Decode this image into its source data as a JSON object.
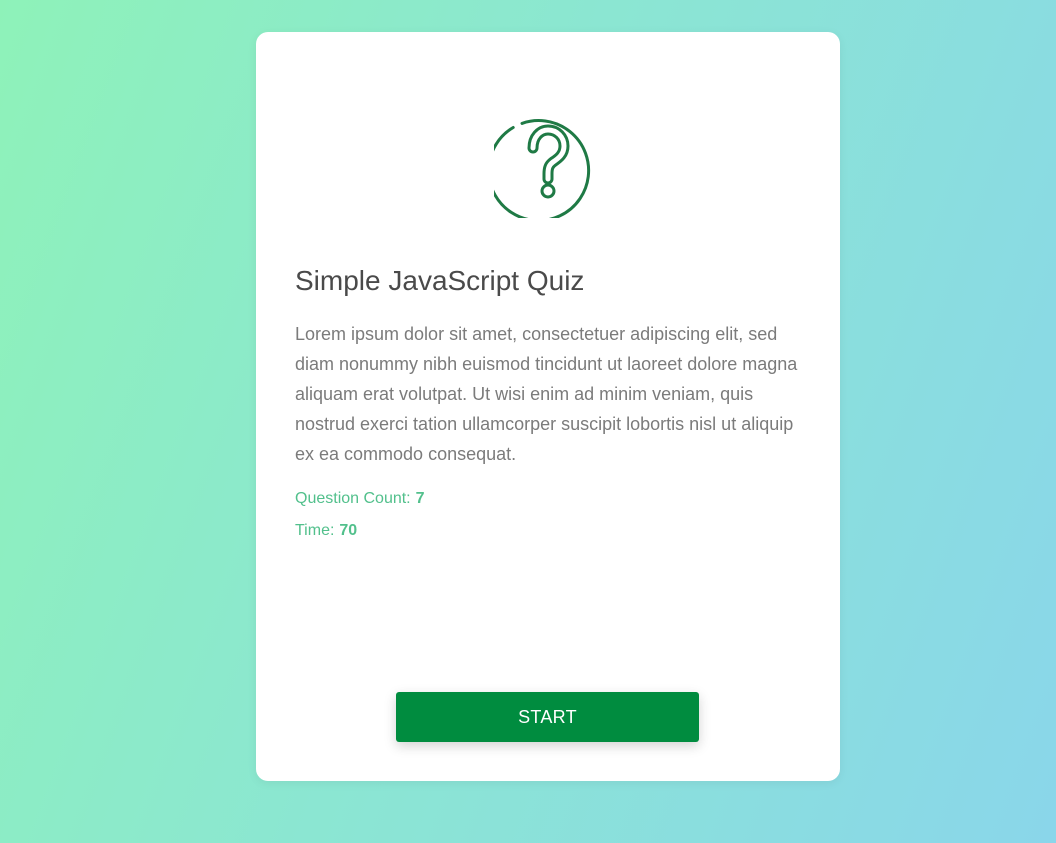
{
  "quiz": {
    "title": "Simple JavaScript Quiz",
    "description": "Lorem ipsum dolor sit amet, consectetuer adipiscing elit, sed diam nonummy nibh euismod tincidunt ut laoreet dolore magna aliquam erat volutpat. Ut wisi enim ad minim veniam, quis nostrud exerci tation ullamcorper suscipit lobortis nisl ut aliquip ex ea commodo consequat.",
    "question_count_label": "Question Count:",
    "question_count": "7",
    "time_label": "Time:",
    "time": "70",
    "start_label": "START",
    "icon": "question-circle-icon"
  },
  "colors": {
    "accent": "#008c3f",
    "icon": "#1f7a45",
    "meta_text": "#52c08c",
    "title_text": "#4a4a4a",
    "body_text": "#7b7b7b",
    "background_start": "#8ef2b9",
    "background_end": "#8ad6ea"
  }
}
